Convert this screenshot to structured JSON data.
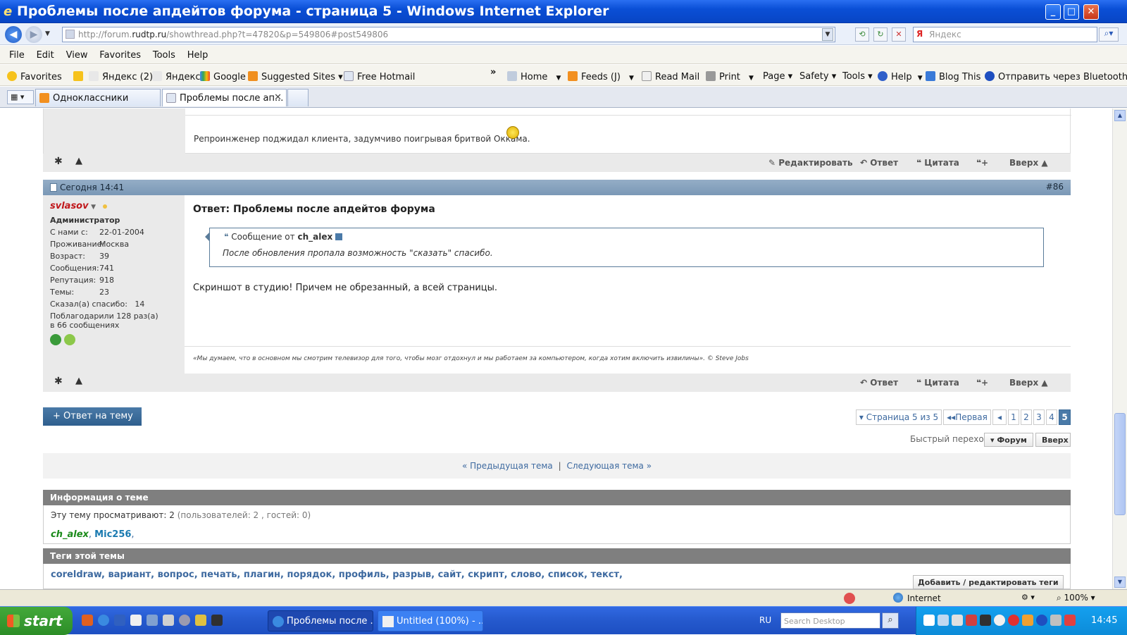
{
  "window": {
    "title": "Проблемы после апдейтов форума - страница 5 - Windows Internet Explorer"
  },
  "address": {
    "url_prefix": "http://forum.",
    "url_domain": "rudtp.ru",
    "url_rest": "/showthread.php?t=47820&p=549806#post549806",
    "search_placeholder": "Яндекс"
  },
  "menu": [
    "File",
    "Edit",
    "View",
    "Favorites",
    "Tools",
    "Help"
  ],
  "favorites_bar": {
    "favorites": "Favorites",
    "items": [
      "Яндекс (2)",
      "Яндекс",
      "Google",
      "Suggested Sites ▾",
      "Free Hotmail"
    ],
    "command_items": [
      "Home",
      "Feeds (J)",
      "Read Mail",
      "Print",
      "Page ▾",
      "Safety ▾",
      "Tools ▾",
      "Help",
      "Blog This",
      "Отправить через Bluetooth"
    ],
    "chevron": "»"
  },
  "tabs": [
    {
      "label": "Одноклассники"
    },
    {
      "label": "Проблемы после ап..."
    }
  ],
  "prev_post": {
    "signature": "Репроинженер поджидал клиента, задумчиво поигрывая бритвой Оккама.",
    "actions": [
      "Редактировать",
      "Ответ",
      "Цитата",
      "Вверх ▲"
    ]
  },
  "post": {
    "date": "Сегодня 14:41",
    "number": "#86",
    "username": "svlasov",
    "role": "Администратор",
    "stats": [
      {
        "k": "С нами с:",
        "v": "22-01-2004"
      },
      {
        "k": "Проживание:",
        "v": "Москва"
      },
      {
        "k": "Возраст:",
        "v": "39"
      },
      {
        "k": "Сообщения:",
        "v": "741"
      },
      {
        "k": "Репутация:",
        "v": "918"
      },
      {
        "k": "Темы:",
        "v": "23"
      },
      {
        "k": "Сказал(а) спасибо:",
        "v": "14"
      }
    ],
    "thanked": "Поблагодарили 128 раз(а)",
    "thanked2": "в 66 сообщениях",
    "title": "Ответ: Проблемы после апдейтов форума",
    "quote_from": "Сообщение от",
    "quote_author": "ch_alex",
    "quote_text": "После обновления пропала возможность \"сказать\" спасибо.",
    "text": "Скриншот в студию! Причем не обрезанный, а всей страницы.",
    "signature": "«Мы думаем, что в основном мы смотрим телевизор для того, чтобы мозг отдохнул и мы работаем за компьютером, когда хотим включить извилины». © Steve Jobs",
    "actions": [
      "Ответ",
      "Цитата",
      "Вверх ▲"
    ]
  },
  "reply_button": "+ Ответ на тему",
  "pagination": {
    "label": "▾ Страница 5 из 5",
    "first": "Первая",
    "pages": [
      "1",
      "2",
      "3",
      "4",
      "5"
    ],
    "current": "5"
  },
  "quick_nav": {
    "label": "Быстрый переход",
    "forum": "▾ Форум",
    "top": "Вверх"
  },
  "thread_nav": {
    "prev": "« Предыдущая тема",
    "sep": "|",
    "next": "Следующая тема »"
  },
  "info_block": {
    "header": "Информация о теме",
    "viewing_label": "Эту тему просматривают:",
    "viewing_count": "2",
    "viewing_detail": "(пользователей: 2 , гостей: 0)",
    "users": [
      "ch_alex",
      "Mic256"
    ]
  },
  "tags_block": {
    "header": "Теги этой темы",
    "tags": "coreldraw, вариант, вопрос, печать, плагин, порядок, профиль, разрыв, сайт, скрипт, слово, список, текст,",
    "edit_button": "Добавить / редактировать теги"
  },
  "statusbar": {
    "zone": "Internet",
    "zoom": "100%"
  },
  "taskbar": {
    "start": "start",
    "tasks": [
      "Проблемы после ...",
      "Untitled (100%) - ..."
    ],
    "lang": "RU",
    "search_placeholder": "Search Desktop",
    "time": "14:45"
  },
  "colors": {
    "title_blue": "#0a4fd6",
    "post_header": "#7a98b6",
    "username_red": "#c0181c",
    "link_blue": "#3e6aa0",
    "block_header_gray": "#7f7f7f",
    "taskbar_blue": "#2559cd",
    "start_green": "#2c8d27"
  }
}
